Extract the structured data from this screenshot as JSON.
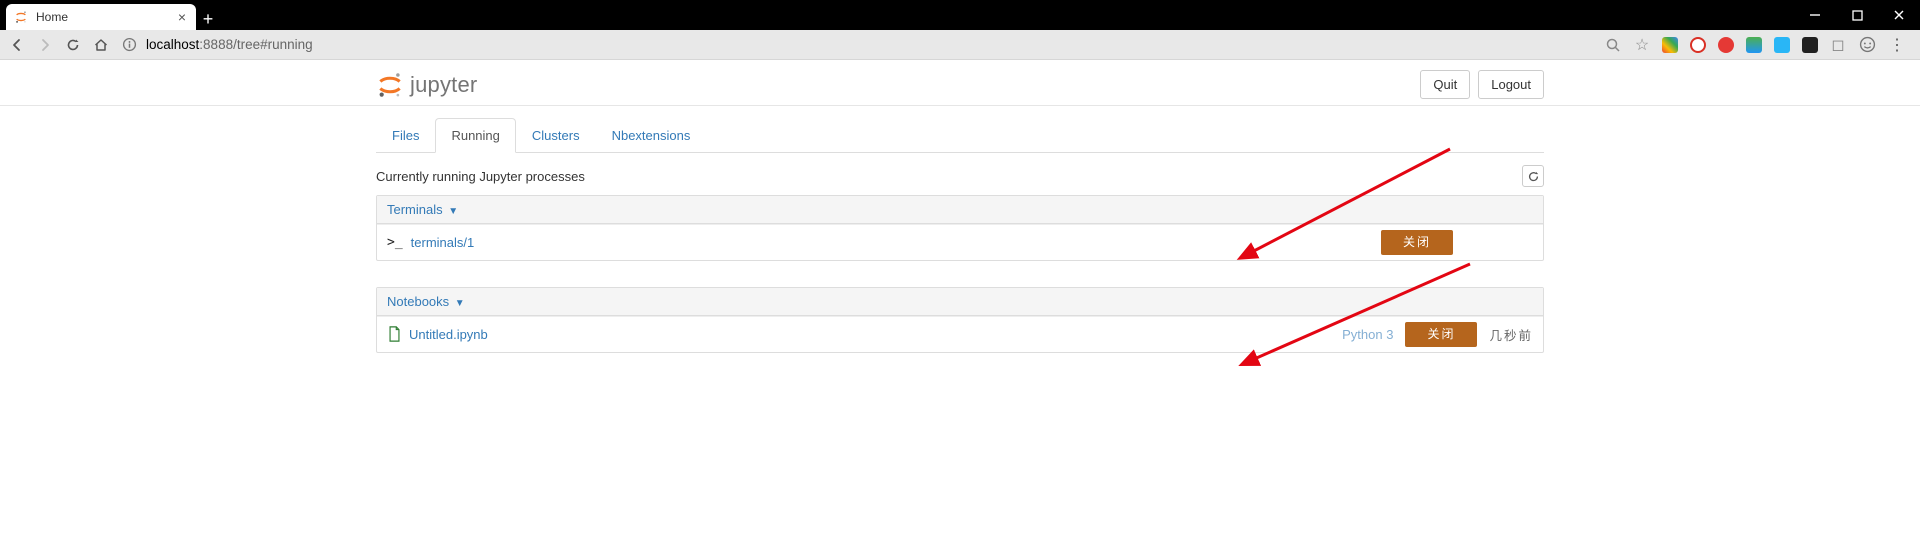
{
  "browser": {
    "tab_title": "Home",
    "url_host": "localhost",
    "url_rest": ":8888/tree#running"
  },
  "header": {
    "logo_text": "jupyter",
    "quit_label": "Quit",
    "logout_label": "Logout"
  },
  "tabs": {
    "files": "Files",
    "running": "Running",
    "clusters": "Clusters",
    "nbextensions": "Nbextensions"
  },
  "running": {
    "description": "Currently running Jupyter processes",
    "terminals_header": "Terminals",
    "terminals": [
      {
        "name": "terminals/1",
        "shutdown_label": "关闭"
      }
    ],
    "notebooks_header": "Notebooks",
    "notebooks": [
      {
        "name": "Untitled.ipynb",
        "kernel": "Python 3",
        "shutdown_label": "关闭",
        "time_ago": "几秒前"
      }
    ]
  }
}
